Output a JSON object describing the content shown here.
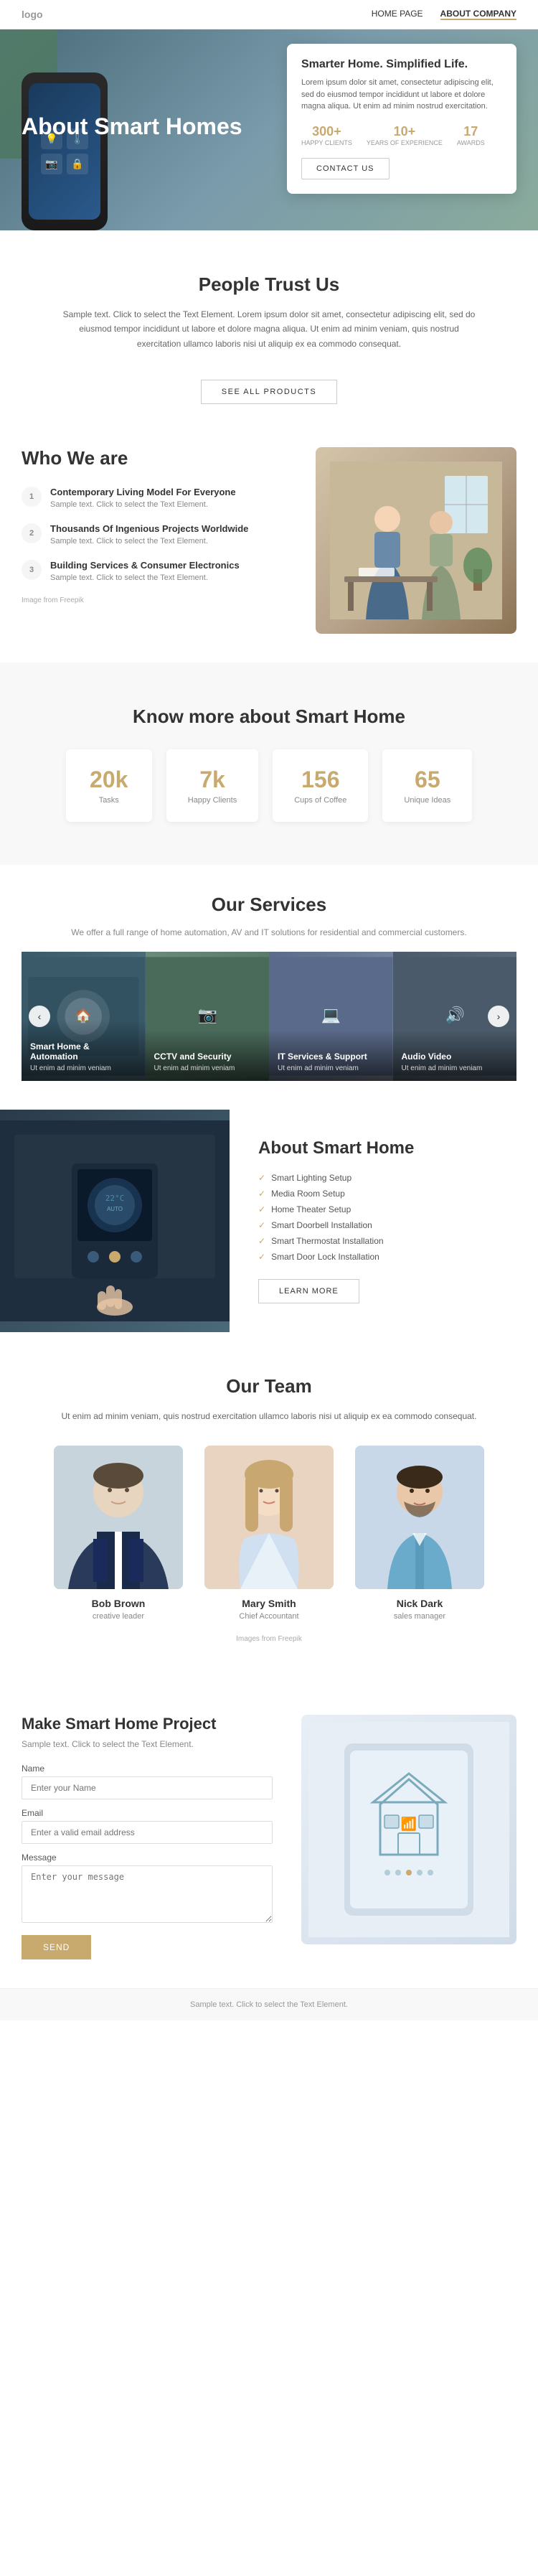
{
  "nav": {
    "logo": "logo",
    "links": [
      {
        "label": "HOME PAGE",
        "active": false
      },
      {
        "label": "ABOUT COMPANY",
        "active": true
      }
    ]
  },
  "hero": {
    "title": "About Smart Homes",
    "card": {
      "title": "Smarter Home. Simplified Life.",
      "text": "Lorem ipsum dolor sit amet, consectetur adipiscing elit, sed do eiusmod tempor incididunt ut labore et dolore magna aliqua. Ut enim ad minim nostrud exercitation.",
      "stats": [
        {
          "number": "300+",
          "label": "HAPPY CLIENTS"
        },
        {
          "number": "10+",
          "label": "YEARS OF EXPERIENCE"
        },
        {
          "number": "17",
          "label": "AWARDS"
        }
      ],
      "contact_btn": "CONTACT US"
    }
  },
  "trust": {
    "title": "People Trust Us",
    "text": "Sample text. Click to select the Text Element. Lorem ipsum dolor sit amet, consectetur adipiscing elit, sed do eiusmod tempor incididunt ut labore et dolore magna aliqua. Ut enim ad minim veniam, quis nostrud exercitation ullamco laboris nisi ut aliquip ex ea commodo consequat.",
    "btn": "SEE ALL PRODUCTS"
  },
  "who": {
    "title": "Who We are",
    "items": [
      {
        "num": "1",
        "title": "Contemporary Living Model For Everyone",
        "text": "Sample text. Click to select the Text Element."
      },
      {
        "num": "2",
        "title": "Thousands Of Ingenious Projects Worldwide",
        "text": "Sample text. Click to select the Text Element."
      },
      {
        "num": "3",
        "title": "Building Services & Consumer Electronics",
        "text": "Sample text. Click to select the Text Element."
      }
    ],
    "image_credit": "Image from Freepik"
  },
  "know": {
    "title": "Know more about Smart Home",
    "stats": [
      {
        "number": "20k",
        "label": "Tasks"
      },
      {
        "number": "7k",
        "label": "Happy Clients"
      },
      {
        "number": "156",
        "label": "Cups of Coffee"
      },
      {
        "number": "65",
        "label": "Unique Ideas"
      }
    ]
  },
  "services": {
    "title": "Our Services",
    "subtitle": "We offer a full range of home automation, AV and IT solutions for residential and commercial customers.",
    "cards": [
      {
        "name": "Smart Home & Automation",
        "desc": "Ut enim ad minim veniam"
      },
      {
        "name": "CCTV and Security",
        "desc": "Ut enim ad minim veniam"
      },
      {
        "name": "IT Services & Support",
        "desc": "Ut enim ad minim veniam"
      },
      {
        "name": "Audio Video",
        "desc": "Ut enim ad minim veniam"
      }
    ]
  },
  "about_home": {
    "title": "About Smart Home",
    "list": [
      "Smart Lighting Setup",
      "Media Room Setup",
      "Home Theater Setup",
      "Smart Doorbell Installation",
      "Smart Thermostat Installation",
      "Smart Door Lock Installation"
    ],
    "btn": "LEARN MORE"
  },
  "team": {
    "title": "Our Team",
    "subtitle": "Ut enim ad minim veniam, quis nostrud exercitation ullamco laboris nisi ut aliquip ex ea commodo consequat.",
    "members": [
      {
        "name": "Bob Brown",
        "role": "creative leader",
        "photo_class": "bob"
      },
      {
        "name": "Mary Smith",
        "role": "Chief Accountant",
        "photo_class": "mary"
      },
      {
        "name": "Nick Dark",
        "role": "sales manager",
        "photo_class": "nick"
      }
    ],
    "image_credit": "Images from Freepik"
  },
  "contact": {
    "title": "Make Smart Home Project",
    "subtitle": "Sample text. Click to select the Text Element.",
    "fields": [
      {
        "label": "Name",
        "placeholder": "Enter your Name",
        "type": "text"
      },
      {
        "label": "Email",
        "placeholder": "Enter a valid email address",
        "type": "email"
      },
      {
        "label": "Message",
        "placeholder": "Enter your message",
        "type": "textarea"
      }
    ],
    "btn": "SEND"
  },
  "footer": {
    "text": "Sample text. Click to select the Text Element."
  }
}
